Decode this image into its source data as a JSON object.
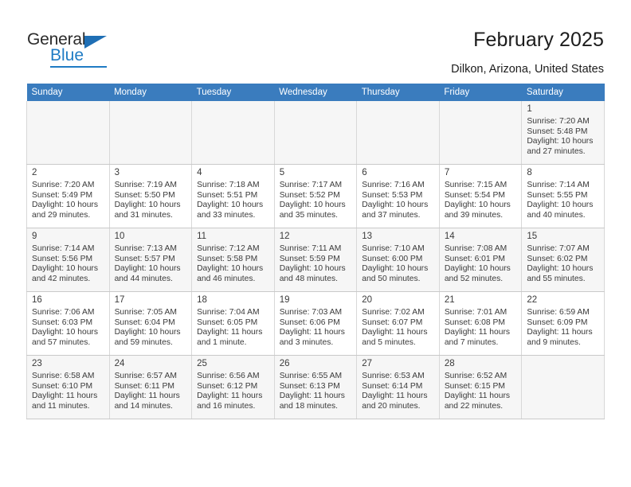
{
  "brand": {
    "name_top": "General",
    "name_bottom": "Blue",
    "accent_color": "#1f7bc4",
    "triangle_color": "#1f6fb5"
  },
  "header": {
    "title": "February 2025",
    "subtitle": "Dilkon, Arizona, United States",
    "header_bg": "#3a7cbe",
    "header_text_color": "#ffffff"
  },
  "weekdays": [
    "Sunday",
    "Monday",
    "Tuesday",
    "Wednesday",
    "Thursday",
    "Friday",
    "Saturday"
  ],
  "weeks": [
    [
      {
        "day": "",
        "sunrise": "",
        "sunset": "",
        "daylight": "",
        "empty": true
      },
      {
        "day": "",
        "sunrise": "",
        "sunset": "",
        "daylight": "",
        "empty": true
      },
      {
        "day": "",
        "sunrise": "",
        "sunset": "",
        "daylight": "",
        "empty": true
      },
      {
        "day": "",
        "sunrise": "",
        "sunset": "",
        "daylight": "",
        "empty": true
      },
      {
        "day": "",
        "sunrise": "",
        "sunset": "",
        "daylight": "",
        "empty": true
      },
      {
        "day": "",
        "sunrise": "",
        "sunset": "",
        "daylight": "",
        "empty": true
      },
      {
        "day": "1",
        "sunrise": "Sunrise: 7:20 AM",
        "sunset": "Sunset: 5:48 PM",
        "daylight": "Daylight: 10 hours and 27 minutes.",
        "empty": false
      }
    ],
    [
      {
        "day": "2",
        "sunrise": "Sunrise: 7:20 AM",
        "sunset": "Sunset: 5:49 PM",
        "daylight": "Daylight: 10 hours and 29 minutes.",
        "empty": false
      },
      {
        "day": "3",
        "sunrise": "Sunrise: 7:19 AM",
        "sunset": "Sunset: 5:50 PM",
        "daylight": "Daylight: 10 hours and 31 minutes.",
        "empty": false
      },
      {
        "day": "4",
        "sunrise": "Sunrise: 7:18 AM",
        "sunset": "Sunset: 5:51 PM",
        "daylight": "Daylight: 10 hours and 33 minutes.",
        "empty": false
      },
      {
        "day": "5",
        "sunrise": "Sunrise: 7:17 AM",
        "sunset": "Sunset: 5:52 PM",
        "daylight": "Daylight: 10 hours and 35 minutes.",
        "empty": false
      },
      {
        "day": "6",
        "sunrise": "Sunrise: 7:16 AM",
        "sunset": "Sunset: 5:53 PM",
        "daylight": "Daylight: 10 hours and 37 minutes.",
        "empty": false
      },
      {
        "day": "7",
        "sunrise": "Sunrise: 7:15 AM",
        "sunset": "Sunset: 5:54 PM",
        "daylight": "Daylight: 10 hours and 39 minutes.",
        "empty": false
      },
      {
        "day": "8",
        "sunrise": "Sunrise: 7:14 AM",
        "sunset": "Sunset: 5:55 PM",
        "daylight": "Daylight: 10 hours and 40 minutes.",
        "empty": false
      }
    ],
    [
      {
        "day": "9",
        "sunrise": "Sunrise: 7:14 AM",
        "sunset": "Sunset: 5:56 PM",
        "daylight": "Daylight: 10 hours and 42 minutes.",
        "empty": false
      },
      {
        "day": "10",
        "sunrise": "Sunrise: 7:13 AM",
        "sunset": "Sunset: 5:57 PM",
        "daylight": "Daylight: 10 hours and 44 minutes.",
        "empty": false
      },
      {
        "day": "11",
        "sunrise": "Sunrise: 7:12 AM",
        "sunset": "Sunset: 5:58 PM",
        "daylight": "Daylight: 10 hours and 46 minutes.",
        "empty": false
      },
      {
        "day": "12",
        "sunrise": "Sunrise: 7:11 AM",
        "sunset": "Sunset: 5:59 PM",
        "daylight": "Daylight: 10 hours and 48 minutes.",
        "empty": false
      },
      {
        "day": "13",
        "sunrise": "Sunrise: 7:10 AM",
        "sunset": "Sunset: 6:00 PM",
        "daylight": "Daylight: 10 hours and 50 minutes.",
        "empty": false
      },
      {
        "day": "14",
        "sunrise": "Sunrise: 7:08 AM",
        "sunset": "Sunset: 6:01 PM",
        "daylight": "Daylight: 10 hours and 52 minutes.",
        "empty": false
      },
      {
        "day": "15",
        "sunrise": "Sunrise: 7:07 AM",
        "sunset": "Sunset: 6:02 PM",
        "daylight": "Daylight: 10 hours and 55 minutes.",
        "empty": false
      }
    ],
    [
      {
        "day": "16",
        "sunrise": "Sunrise: 7:06 AM",
        "sunset": "Sunset: 6:03 PM",
        "daylight": "Daylight: 10 hours and 57 minutes.",
        "empty": false
      },
      {
        "day": "17",
        "sunrise": "Sunrise: 7:05 AM",
        "sunset": "Sunset: 6:04 PM",
        "daylight": "Daylight: 10 hours and 59 minutes.",
        "empty": false
      },
      {
        "day": "18",
        "sunrise": "Sunrise: 7:04 AM",
        "sunset": "Sunset: 6:05 PM",
        "daylight": "Daylight: 11 hours and 1 minute.",
        "empty": false
      },
      {
        "day": "19",
        "sunrise": "Sunrise: 7:03 AM",
        "sunset": "Sunset: 6:06 PM",
        "daylight": "Daylight: 11 hours and 3 minutes.",
        "empty": false
      },
      {
        "day": "20",
        "sunrise": "Sunrise: 7:02 AM",
        "sunset": "Sunset: 6:07 PM",
        "daylight": "Daylight: 11 hours and 5 minutes.",
        "empty": false
      },
      {
        "day": "21",
        "sunrise": "Sunrise: 7:01 AM",
        "sunset": "Sunset: 6:08 PM",
        "daylight": "Daylight: 11 hours and 7 minutes.",
        "empty": false
      },
      {
        "day": "22",
        "sunrise": "Sunrise: 6:59 AM",
        "sunset": "Sunset: 6:09 PM",
        "daylight": "Daylight: 11 hours and 9 minutes.",
        "empty": false
      }
    ],
    [
      {
        "day": "23",
        "sunrise": "Sunrise: 6:58 AM",
        "sunset": "Sunset: 6:10 PM",
        "daylight": "Daylight: 11 hours and 11 minutes.",
        "empty": false
      },
      {
        "day": "24",
        "sunrise": "Sunrise: 6:57 AM",
        "sunset": "Sunset: 6:11 PM",
        "daylight": "Daylight: 11 hours and 14 minutes.",
        "empty": false
      },
      {
        "day": "25",
        "sunrise": "Sunrise: 6:56 AM",
        "sunset": "Sunset: 6:12 PM",
        "daylight": "Daylight: 11 hours and 16 minutes.",
        "empty": false
      },
      {
        "day": "26",
        "sunrise": "Sunrise: 6:55 AM",
        "sunset": "Sunset: 6:13 PM",
        "daylight": "Daylight: 11 hours and 18 minutes.",
        "empty": false
      },
      {
        "day": "27",
        "sunrise": "Sunrise: 6:53 AM",
        "sunset": "Sunset: 6:14 PM",
        "daylight": "Daylight: 11 hours and 20 minutes.",
        "empty": false
      },
      {
        "day": "28",
        "sunrise": "Sunrise: 6:52 AM",
        "sunset": "Sunset: 6:15 PM",
        "daylight": "Daylight: 11 hours and 22 minutes.",
        "empty": false
      },
      {
        "day": "",
        "sunrise": "",
        "sunset": "",
        "daylight": "",
        "empty": true
      }
    ]
  ]
}
